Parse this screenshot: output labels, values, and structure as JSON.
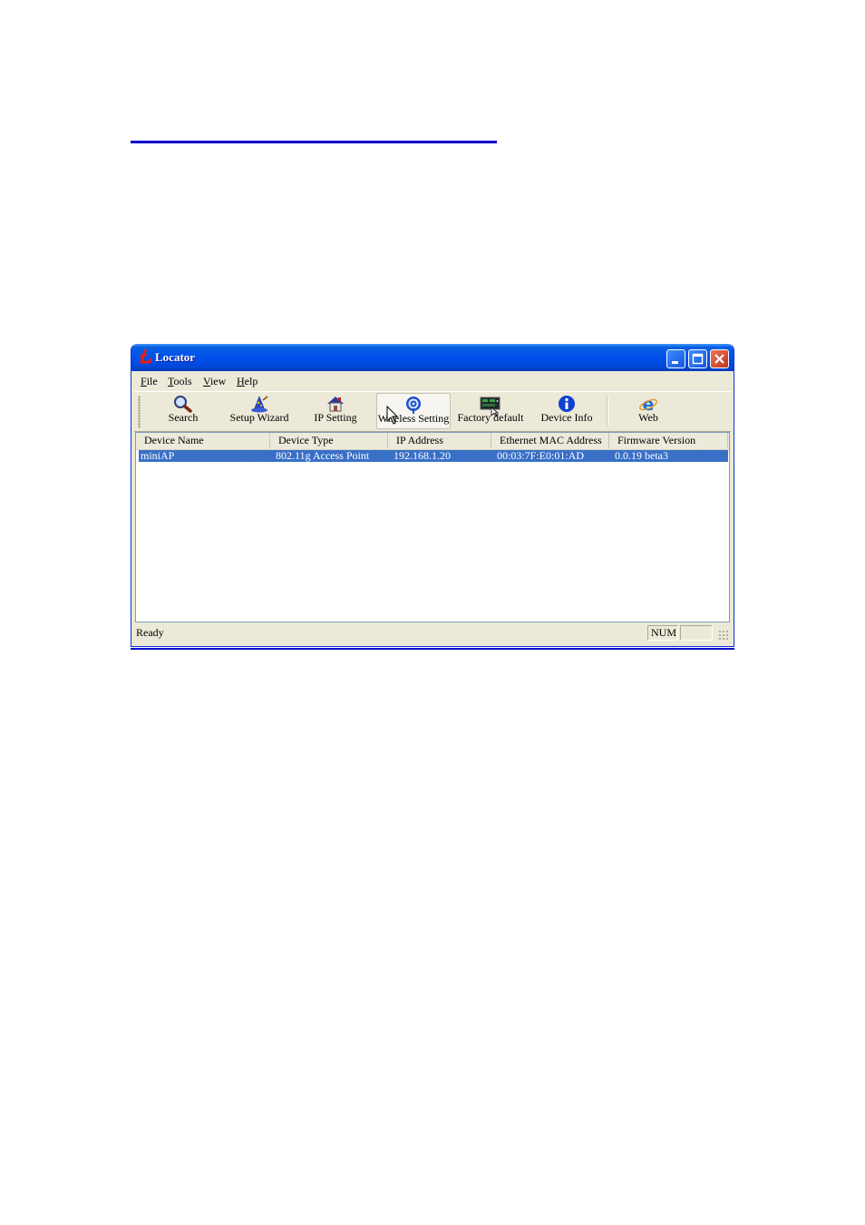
{
  "window": {
    "title": "Locator"
  },
  "menu": [
    {
      "key": "F",
      "rest": "ile"
    },
    {
      "key": "T",
      "rest": "ools"
    },
    {
      "key": "V",
      "rest": "iew"
    },
    {
      "key": "H",
      "rest": "elp"
    }
  ],
  "toolbar": {
    "search": "Search",
    "setup_wizard": "Setup Wizard",
    "ip_setting": "IP Setting",
    "wireless_setting": "Wireless Setting",
    "factory_default": "Factory default",
    "device_info": "Device Info",
    "web": "Web"
  },
  "columns": [
    "Device Name",
    "Device Type",
    "IP Address",
    "Ethernet MAC Address",
    "Firmware Version"
  ],
  "rows": [
    [
      "miniAP",
      "802.11g Access Point",
      "192.168.1.20",
      "00:03:7F:E0:01:AD",
      "0.0.19 beta3"
    ]
  ],
  "status": {
    "text": "Ready",
    "num": "NUM"
  },
  "colors": {
    "title_bar": "#0050ee",
    "selection": "#316ac5",
    "rule": "#0000cc"
  },
  "icons": [
    "search-icon",
    "wizard-icon",
    "ip-setting-icon",
    "wireless-icon",
    "factory-default-icon",
    "device-info-icon",
    "web-icon"
  ]
}
